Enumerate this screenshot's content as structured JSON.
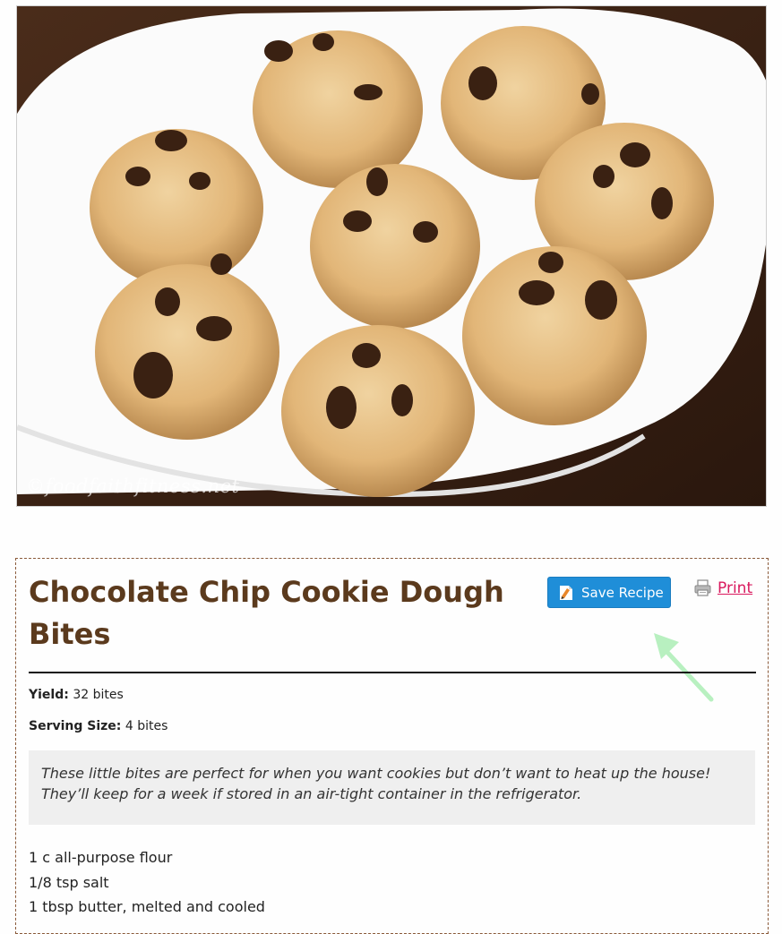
{
  "photo": {
    "watermark": "©foodfaithfitness.net",
    "subject": "cookie-dough-bites-photo"
  },
  "recipe": {
    "title": "Chocolate Chip Cookie Dough Bites",
    "save_button_label": "Save Recipe",
    "print_label": "Print",
    "yield_label": "Yield:",
    "yield_value": "32 bites",
    "serving_label": "Serving Size:",
    "serving_value": "4 bites",
    "summary": "These little bites are perfect for when you want cookies but don’t want to heat up the house! They’ll keep for a week if stored in an air-tight container in the refrigerator.",
    "ingredients": [
      "1 c all-purpose flour",
      "1/8 tsp salt",
      "1 tbsp butter, melted and cooled"
    ]
  },
  "icons": {
    "save": "save-recipe-icon",
    "print": "printer-icon",
    "annotation": "arrow-pointer-icon"
  },
  "colors": {
    "title": "#5b3a1d",
    "save_button": "#1f8ed8",
    "print_link": "#d91a5e",
    "arrow": "#b8f0c0"
  }
}
